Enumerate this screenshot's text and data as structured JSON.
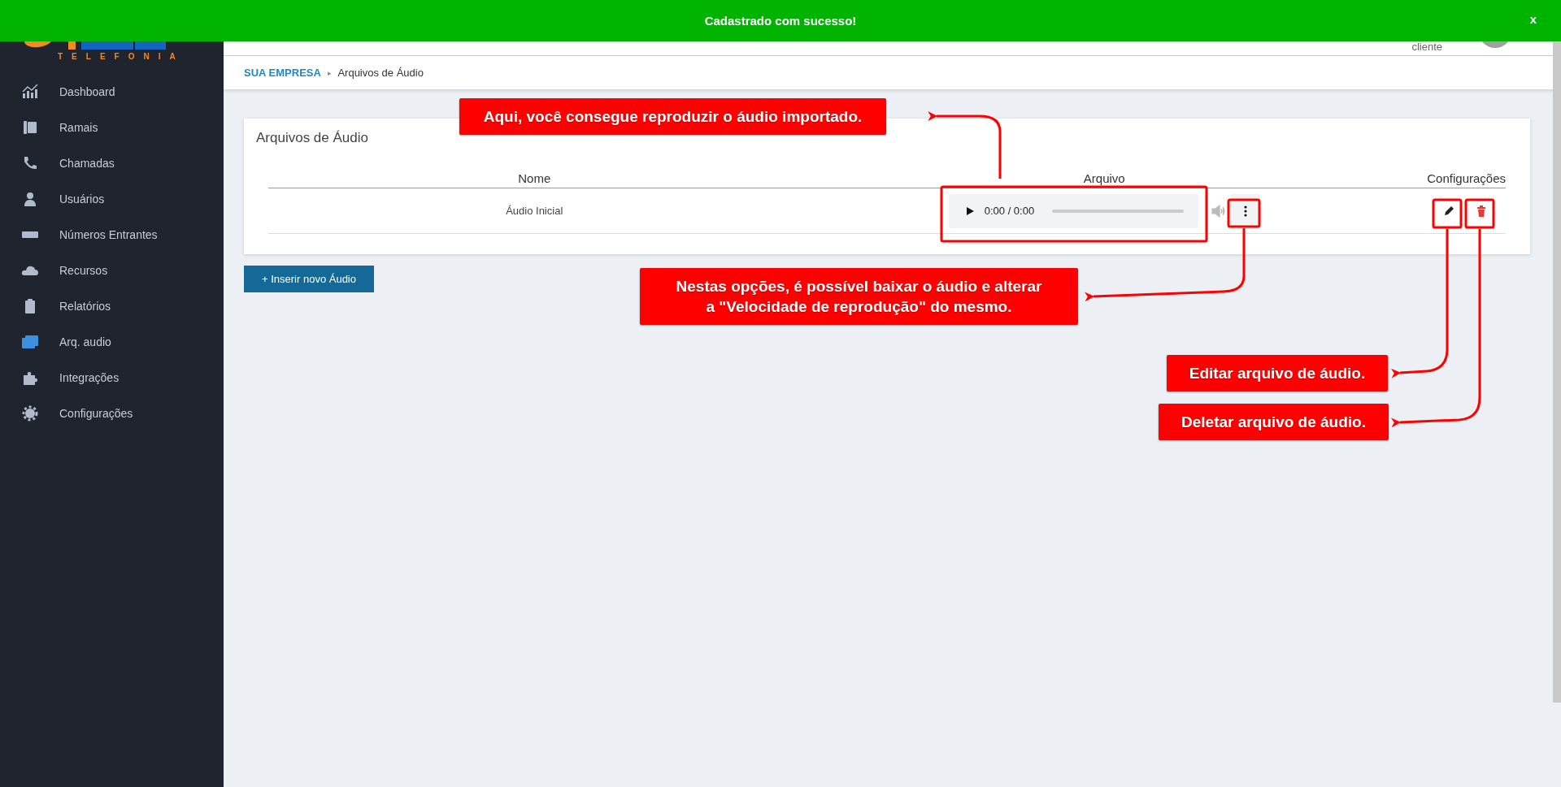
{
  "notification": {
    "message": "Cadastrado com sucesso!",
    "close": "x"
  },
  "logo": {
    "subtitle": "TELEFONIA"
  },
  "sidebar": {
    "items": [
      {
        "label": "Dashboard",
        "selected": false
      },
      {
        "label": "Ramais",
        "selected": false
      },
      {
        "label": "Chamadas",
        "selected": false
      },
      {
        "label": "Usuários",
        "selected": false
      },
      {
        "label": "Números Entrantes",
        "selected": false
      },
      {
        "label": "Recursos",
        "selected": false
      },
      {
        "label": "Relatórios",
        "selected": false
      },
      {
        "label": "Arq. audio",
        "selected": true
      },
      {
        "label": "Integrações",
        "selected": false
      },
      {
        "label": "Configurações",
        "selected": false
      }
    ]
  },
  "header": {
    "user_role": "cliente"
  },
  "breadcrumb": {
    "root": "SUA EMPRESA",
    "separator": "▸",
    "current": "Arquivos de Áudio"
  },
  "card": {
    "title": "Arquivos de Áudio",
    "table": {
      "columns": [
        "Nome",
        "Arquivo",
        "Configurações"
      ],
      "rows": [
        {
          "name": "Áudio Inicial",
          "player_time": "0:00 / 0:00"
        }
      ]
    }
  },
  "add_button": "+ Inserir novo Áudio",
  "annotations": [
    {
      "lines": [
        "Aqui, você consegue reproduzir o áudio importado."
      ]
    },
    {
      "lines": [
        "Nestas opções, é possível baixar o áudio e alterar",
        "a \"Velocidade de reprodução\" do mesmo."
      ]
    },
    {
      "lines": [
        "Editar arquivo de áudio."
      ]
    },
    {
      "lines": [
        "Deletar arquivo de áudio."
      ]
    }
  ]
}
